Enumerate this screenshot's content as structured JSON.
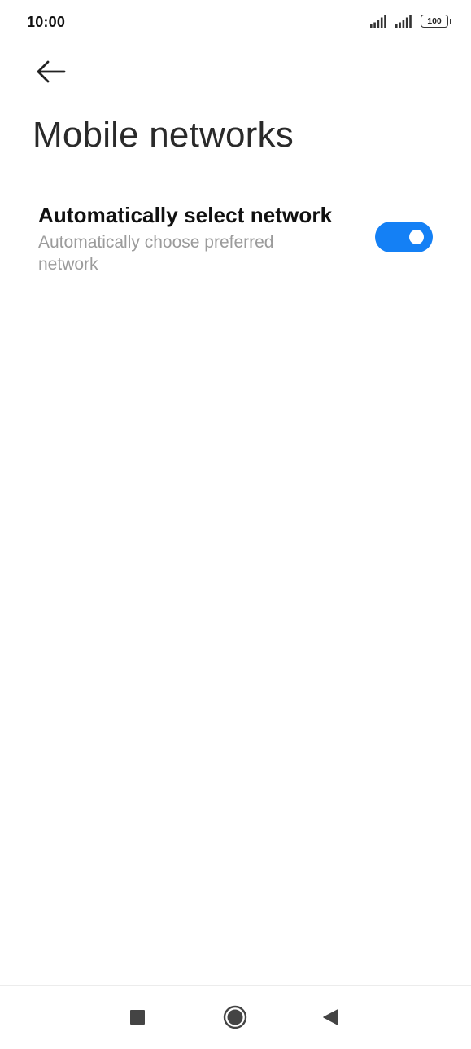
{
  "status_bar": {
    "time": "10:00",
    "battery_level": "100"
  },
  "header": {
    "title": "Mobile networks"
  },
  "settings": {
    "auto_select": {
      "title": "Automatically select network",
      "summary": "Automatically choose preferred network",
      "enabled": true
    }
  },
  "colors": {
    "accent": "#1480f5",
    "title_text": "#2a2a2a",
    "summary_text": "#9b9b9b"
  },
  "icons": {
    "back": "arrow-left-icon",
    "signal_1": "signal-strength-icon",
    "signal_2": "signal-strength-icon",
    "battery": "battery-icon",
    "nav_recents": "square-icon",
    "nav_home": "circle-icon",
    "nav_back": "triangle-back-icon"
  }
}
